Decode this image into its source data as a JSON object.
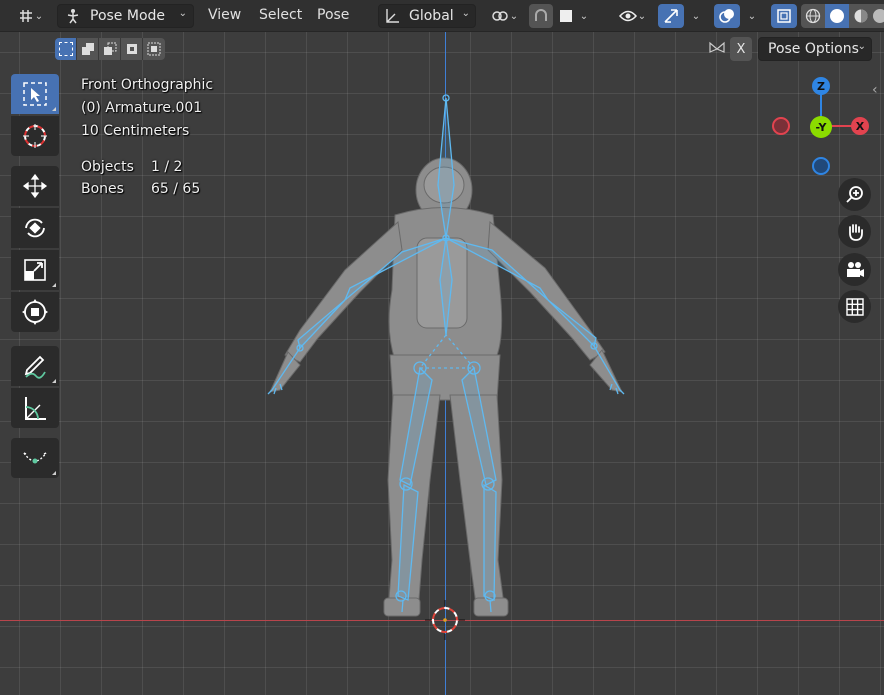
{
  "header": {
    "mode_label": "Pose Mode",
    "menus": [
      "View",
      "Select",
      "Pose"
    ],
    "orientation_label": "Global",
    "pose_options_label": "Pose Options",
    "x_mirror_label": "X"
  },
  "overlay": {
    "view_name": "Front Orthographic",
    "object_name": "(0) Armature.001",
    "grid_scale": "10 Centimeters",
    "stats": [
      {
        "label": "Objects",
        "value": "1 / 2"
      },
      {
        "label": "Bones",
        "value": "65 / 65"
      }
    ]
  },
  "gizmo": {
    "z_label": "Z",
    "y_label": "-Y",
    "x_label": "X",
    "x_color": "#e2434f",
    "y_color": "#8bdc00",
    "z_color": "#2f85e3"
  },
  "colors": {
    "active_tool": "#4772b3",
    "bone_outline": "#5fb9f0"
  }
}
